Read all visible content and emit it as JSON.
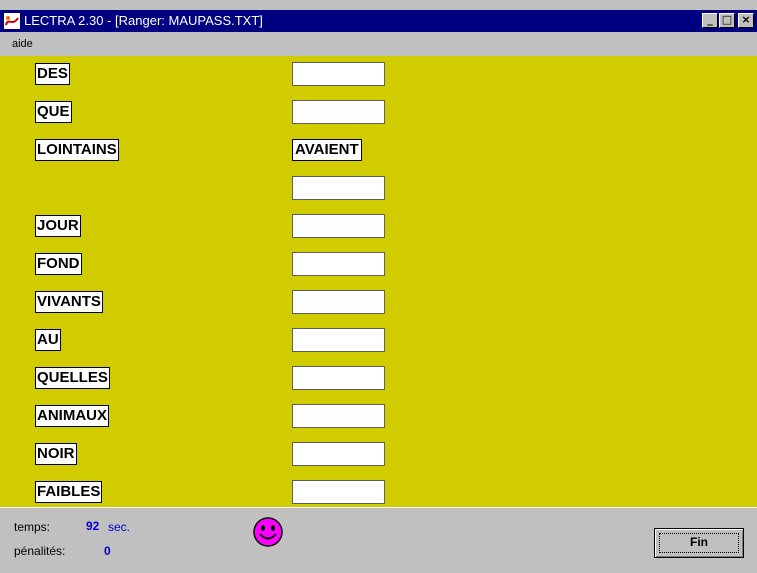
{
  "window": {
    "title": "LECTRA 2.30 - [Ranger: MAUPASS.TXT]",
    "app_icon": "lectra-logo-icon",
    "controls": {
      "minimize": "_",
      "maximize": "□",
      "close": "×"
    }
  },
  "menu": {
    "items": [
      "aide"
    ]
  },
  "words": [
    "DES",
    "QUE",
    "LOINTAINS",
    "JOUR",
    "FOND",
    "VIVANTS",
    "AU",
    "QUELLES",
    "ANIMAUX",
    "NOIR",
    "FAIBLES"
  ],
  "answer_slots": [
    "",
    "",
    "AVAIENT",
    "",
    "",
    "",
    "",
    "",
    "",
    "",
    "",
    ""
  ],
  "status": {
    "time_label": "temps:",
    "time_value": "92",
    "time_unit": "sec.",
    "penalty_label": "pénalités:",
    "penalty_value": "0",
    "mood_icon": "smiley-face-icon"
  },
  "buttons": {
    "fin": "Fin"
  },
  "colors": {
    "workspace": "#d0cc00",
    "titlebar": "#000080",
    "smiley": "#ff00ff",
    "stat_value": "#0000cc"
  }
}
